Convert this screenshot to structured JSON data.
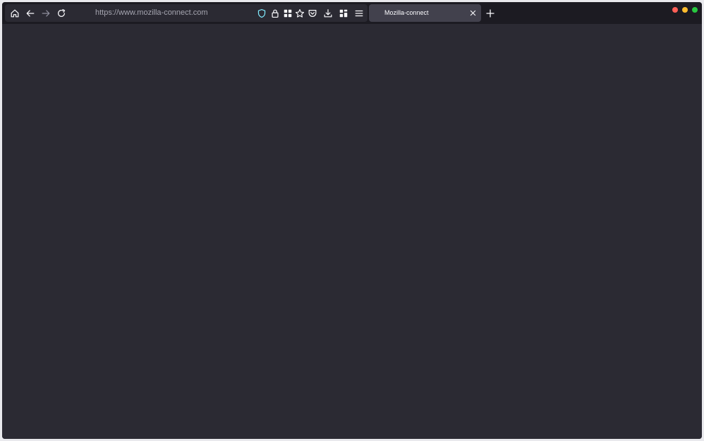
{
  "browser": {
    "url": "https://www.mozilla-connect.com",
    "tab_title": "Mozilla-connect"
  },
  "icons": {
    "home": "home-icon",
    "back": "arrow-left-icon",
    "forward": "arrow-right-icon",
    "reload": "reload-icon",
    "tracking_protection": "shield-icon",
    "site_security": "lock-icon",
    "extensions": "grid-icon",
    "bookmark": "star-icon",
    "pocket": "pocket-icon",
    "downloads": "download-icon",
    "containers": "widgets-icon",
    "menu": "hamburger-menu-icon",
    "close_tab": "close-icon",
    "new_tab": "plus-icon"
  },
  "colors": {
    "toolbar_bg": "#1c1b22",
    "content_bg": "#2b2a33",
    "tab_active_bg": "#42414d",
    "shield_accent": "#80ebff",
    "close_red": "#ff5f57",
    "minimize_yellow": "#febc2e",
    "maximize_green": "#28c840"
  }
}
